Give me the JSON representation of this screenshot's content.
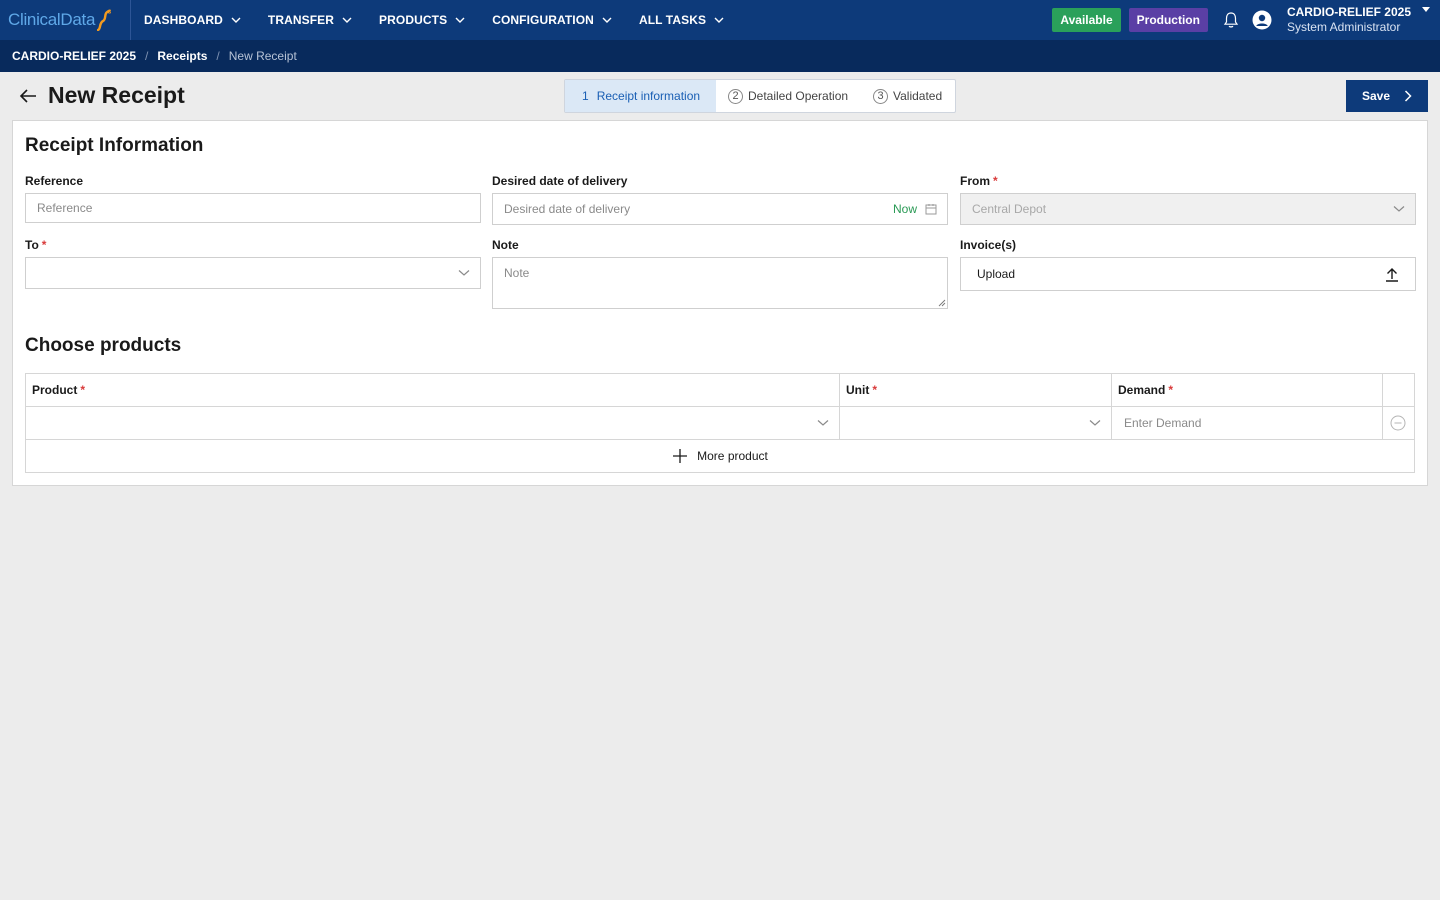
{
  "colors": {
    "nav_bg": "#0d3a7a",
    "crumb_bg": "#082a5c",
    "available": "#2aa05a",
    "production": "#5a3fa5",
    "now_link": "#2a9a55",
    "required": "#d93a3a",
    "step_active": "#1a5fb4"
  },
  "logo": {
    "text": "ClinicalData"
  },
  "nav": {
    "items": [
      {
        "label": "DASHBOARD",
        "icon": "chevron-down-icon"
      },
      {
        "label": "TRANSFER",
        "icon": "chevron-down-icon"
      },
      {
        "label": "PRODUCTS",
        "icon": "chevron-down-icon"
      },
      {
        "label": "CONFIGURATION",
        "icon": "chevron-down-icon"
      },
      {
        "label": "ALL TASKS",
        "icon": "chevron-down-icon"
      }
    ],
    "badge_available": "Available",
    "badge_production": "Production",
    "study": "CARDIO-RELIEF 2025",
    "role": "System Administrator"
  },
  "breadcrumb": {
    "items": [
      "CARDIO-RELIEF 2025",
      "Receipts",
      "New Receipt"
    ],
    "separator": "/"
  },
  "header": {
    "title": "New Receipt",
    "save_label": "Save"
  },
  "stepper": {
    "steps": [
      {
        "num": "1",
        "label": "Receipt information"
      },
      {
        "num": "2",
        "label": "Detailed Operation"
      },
      {
        "num": "3",
        "label": "Validated"
      }
    ],
    "active": 1
  },
  "receipt_info": {
    "title": "Receipt Information",
    "reference": {
      "label": "Reference",
      "placeholder": "Reference"
    },
    "desired_date": {
      "label": "Desired date of delivery",
      "placeholder": "Desired date of delivery",
      "now": "Now"
    },
    "from": {
      "label": "From",
      "value": "Central Depot",
      "required": "*"
    },
    "to": {
      "label": "To",
      "value": "",
      "required": "*"
    },
    "note": {
      "label": "Note",
      "placeholder": "Note"
    },
    "invoices": {
      "label": "Invoice(s)",
      "upload": "Upload"
    }
  },
  "products": {
    "title": "Choose products",
    "columns": [
      {
        "label": "Product",
        "required": "*"
      },
      {
        "label": "Unit",
        "required": "*"
      },
      {
        "label": "Demand",
        "required": "*"
      }
    ],
    "demand_placeholder": "Enter Demand",
    "more_label": "More product"
  }
}
